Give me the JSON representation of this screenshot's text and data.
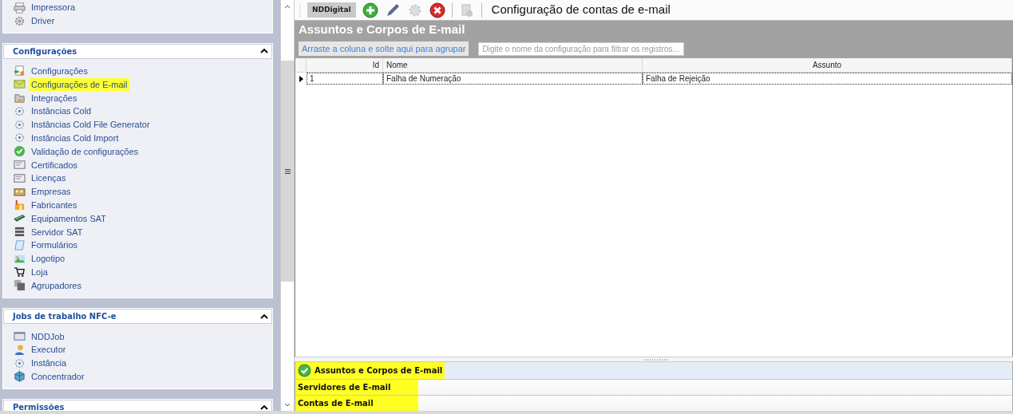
{
  "sidebar": {
    "groups": [
      {
        "items": [
          {
            "label": "Impressora",
            "highlighted": false
          },
          {
            "label": "Driver",
            "highlighted": false
          }
        ]
      },
      {
        "title": "Configurações",
        "expanded": true,
        "items": [
          {
            "label": "Configurações",
            "highlighted": false
          },
          {
            "label": "Configurações de E-mail",
            "highlighted": true
          },
          {
            "label": "Integrações",
            "highlighted": false
          },
          {
            "label": "Instâncias Cold",
            "highlighted": false
          },
          {
            "label": "Instâncias Cold File Generator",
            "highlighted": false
          },
          {
            "label": "Instâncias Cold Import",
            "highlighted": false
          },
          {
            "label": "Validação de configurações",
            "highlighted": false
          },
          {
            "label": "Certificados",
            "highlighted": false
          },
          {
            "label": "Licenças",
            "highlighted": false
          },
          {
            "label": "Empresas",
            "highlighted": false
          },
          {
            "label": "Fabricantes",
            "highlighted": false
          },
          {
            "label": "Equipamentos SAT",
            "highlighted": false
          },
          {
            "label": "Servidor SAT",
            "highlighted": false
          },
          {
            "label": "Formulários",
            "highlighted": false
          },
          {
            "label": "Logotipo",
            "highlighted": false
          },
          {
            "label": "Loja",
            "highlighted": false
          },
          {
            "label": "Agrupadores",
            "highlighted": false
          }
        ]
      },
      {
        "title": "Jobs de trabalho NFC-e",
        "expanded": true,
        "items": [
          {
            "label": "NDDJob",
            "highlighted": false
          },
          {
            "label": "Executor",
            "highlighted": false
          },
          {
            "label": "Instância",
            "highlighted": false
          },
          {
            "label": "Concentrador",
            "highlighted": false
          }
        ]
      },
      {
        "title": "Permissões",
        "expanded": true
      }
    ]
  },
  "toolbar": {
    "brand": "NDDigital",
    "buttons": [
      {
        "kind": "add",
        "disabled": false
      },
      {
        "kind": "edit",
        "disabled": false
      },
      {
        "kind": "settings",
        "disabled": true
      },
      {
        "kind": "delete",
        "disabled": false
      },
      {
        "kind": "report",
        "disabled": true
      }
    ],
    "title": "Configuração de contas de e-mail"
  },
  "panel": {
    "title": "Assuntos e Corpos de E-mail",
    "group_by": "Arraste a coluna e solte aqui para agrupar",
    "filter": {
      "placeholder": "Digite o nome da configuração para filtrar os registros..."
    }
  },
  "table": {
    "columns": [
      {
        "label": "Id"
      },
      {
        "label": "Nome"
      },
      {
        "label": "Assunto"
      }
    ],
    "rows": [
      {
        "selected": true,
        "cells": [
          "1",
          "Falha de Numeração",
          "Falha de Rejeição"
        ]
      }
    ]
  },
  "navigation": [
    {
      "label": "Assuntos e Corpos de E-mail",
      "selected": true,
      "highlighted": true
    },
    {
      "label": "Servidores de E-mail",
      "selected": false,
      "highlighted": true
    },
    {
      "label": "Contas de E-mail",
      "selected": false,
      "highlighted": true
    }
  ]
}
